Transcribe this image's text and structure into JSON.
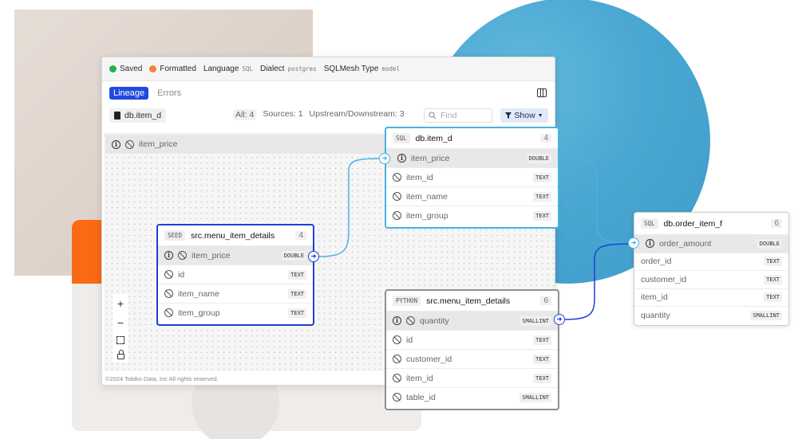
{
  "status": {
    "saved": "Saved",
    "formatted": "Formatted",
    "language_label": "Language",
    "language_value": "SQL",
    "dialect_label": "Dialect",
    "dialect_value": "postgres",
    "type_label": "SQLMesh Type",
    "type_value": "model",
    "saved_color": "#22b14c",
    "formatted_color": "#f47f3c"
  },
  "tabs": [
    "Lineage",
    "Errors"
  ],
  "toolbar": {
    "model": "db.item_d",
    "all": "All: 4",
    "sources": "Sources: 1",
    "upstream": "Upstream/Downstream: 3",
    "find_placeholder": "Find",
    "show": "Show"
  },
  "canvas_row": "item_price",
  "zoom": {
    "plus": "+",
    "minus": "−"
  },
  "footer": "©2024  Tobiko Data, Inc  All rights reserved.",
  "nodes": {
    "seed": {
      "kind": "SEED",
      "name": "src.menu_item_details",
      "count": "4",
      "rows": [
        {
          "name": "item_price",
          "type": "DOUBLE"
        },
        {
          "name": "id",
          "type": "TEXT"
        },
        {
          "name": "item_name",
          "type": "TEXT"
        },
        {
          "name": "item_group",
          "type": "TEXT"
        }
      ]
    },
    "sql": {
      "kind": "SQL",
      "name": "db.item_d",
      "count": "4",
      "rows": [
        {
          "name": "item_price",
          "type": "DOUBLE"
        },
        {
          "name": "item_id",
          "type": "TEXT"
        },
        {
          "name": "item_name",
          "type": "TEXT"
        },
        {
          "name": "item_group",
          "type": "TEXT"
        }
      ]
    },
    "python": {
      "kind": "PYTHON",
      "name": "src.menu_item_details",
      "count": "6",
      "rows": [
        {
          "name": "quantity",
          "type": "SMALLINT"
        },
        {
          "name": "id",
          "type": "TEXT"
        },
        {
          "name": "customer_id",
          "type": "TEXT"
        },
        {
          "name": "item_id",
          "type": "TEXT"
        },
        {
          "name": "table_id",
          "type": "SMALLINT"
        }
      ]
    },
    "order": {
      "kind": "SQL",
      "name": "db.order_item_f",
      "count": "6",
      "rows": [
        {
          "name": "order_amount",
          "type": "DOUBLE"
        },
        {
          "name": "order_id",
          "type": "TEXT"
        },
        {
          "name": "customer_id",
          "type": "TEXT"
        },
        {
          "name": "item_id",
          "type": "TEXT"
        },
        {
          "name": "quantity",
          "type": "SMALLINT"
        }
      ]
    }
  },
  "colors": {
    "seed_edge": "#1f3fd8",
    "sql_edge": "#49b2e3",
    "tab_active": "#1f4ae0"
  }
}
